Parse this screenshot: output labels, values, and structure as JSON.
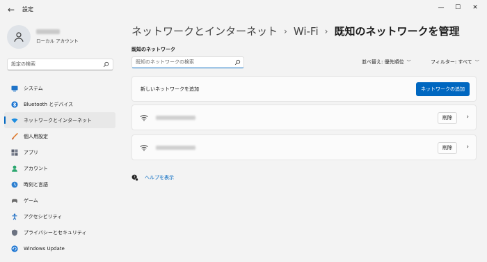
{
  "window": {
    "title": "設定",
    "minimize": "—",
    "maximize": "☐",
    "close": "✕"
  },
  "profile": {
    "account_type": "ローカル アカウント"
  },
  "sidebar": {
    "search_placeholder": "設定の検索",
    "items": [
      {
        "label": "システム",
        "icon": "system-icon",
        "color": "#1e73c8"
      },
      {
        "label": "Bluetooth とデバイス",
        "icon": "bluetooth-icon",
        "color": "#1a74d2"
      },
      {
        "label": "ネットワークとインターネット",
        "icon": "network-icon",
        "color": "#1f8ee0",
        "active": true
      },
      {
        "label": "個人用設定",
        "icon": "brush-icon",
        "color": "#e07a2a"
      },
      {
        "label": "アプリ",
        "icon": "apps-icon",
        "color": "#5b6170"
      },
      {
        "label": "アカウント",
        "icon": "account-icon",
        "color": "#2aa66e"
      },
      {
        "label": "時刻と言語",
        "icon": "globe-clock-icon",
        "color": "#2c7fd0"
      },
      {
        "label": "ゲーム",
        "icon": "game-icon",
        "color": "#6b6b6b"
      },
      {
        "label": "アクセシビリティ",
        "icon": "accessibility-icon",
        "color": "#1f6fc4"
      },
      {
        "label": "プライバシーとセキュリティ",
        "icon": "shield-icon",
        "color": "#6b7280"
      },
      {
        "label": "Windows Update",
        "icon": "update-icon",
        "color": "#1a74d2"
      }
    ]
  },
  "breadcrumb": {
    "level1": "ネットワークとインターネット",
    "level2": "Wi-Fi",
    "current": "既知のネットワークを管理",
    "separator": "›"
  },
  "known_networks": {
    "section_label": "既知のネットワーク",
    "search_placeholder": "既知のネットワークの検索",
    "sort_label": "並べ替え: 優先順位",
    "filter_label": "フィルター: すべて",
    "add_row_label": "新しいネットワークを追加",
    "add_button": "ネットワークの追加",
    "networks": [
      {
        "delete_label": "削除"
      },
      {
        "delete_label": "削除"
      }
    ]
  },
  "help": {
    "link": "ヘルプを表示"
  },
  "colors": {
    "accent": "#0067c0",
    "background": "#f3f3f3"
  }
}
